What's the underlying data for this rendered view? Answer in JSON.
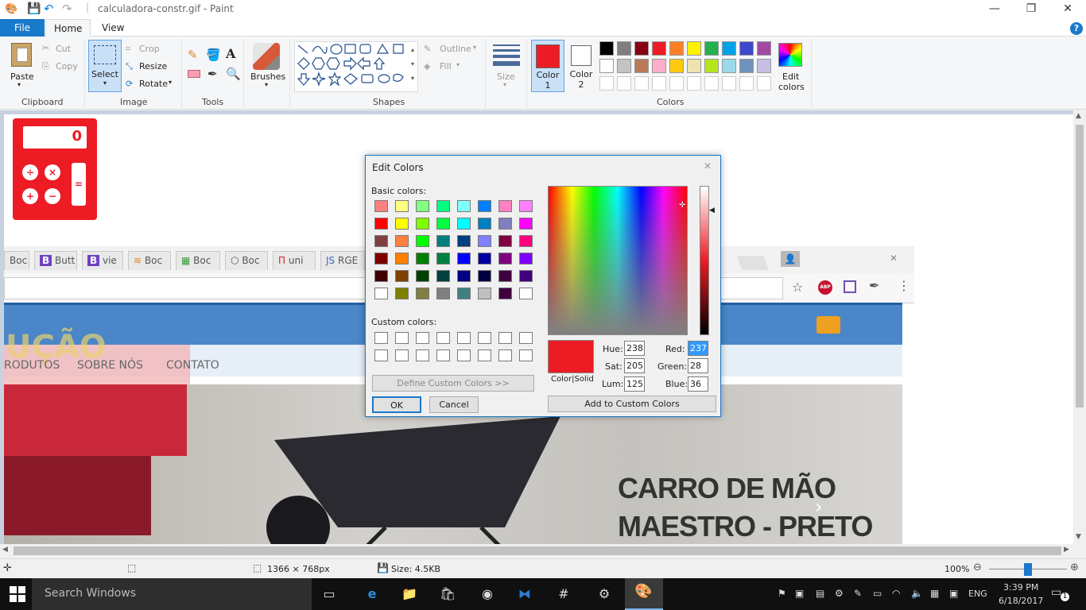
{
  "window": {
    "title": "calculadora-constr.gif - Paint"
  },
  "menu": {
    "file": "File",
    "home": "Home",
    "view": "View",
    "help": "?"
  },
  "clipboard": {
    "paste": "Paste",
    "cut": "Cut",
    "copy": "Copy",
    "label": "Clipboard"
  },
  "image": {
    "select": "Select",
    "crop": "Crop",
    "resize": "Resize",
    "rotate": "Rotate",
    "label": "Image"
  },
  "tools": {
    "label": "Tools",
    "text_tool": "A"
  },
  "brushes": {
    "label": "Brushes"
  },
  "shapes": {
    "label": "Shapes",
    "outline": "Outline",
    "fill": "Fill"
  },
  "size": {
    "label": "Size"
  },
  "colors": {
    "color1_label": "Color",
    "color1_num": "1",
    "color2_label": "Color",
    "color2_num": "2",
    "color1": "#ed1c24",
    "color2": "#ffffff",
    "edit_label": "Edit",
    "edit_label2": "colors",
    "label": "Colors",
    "row1": [
      "#000000",
      "#7f7f7f",
      "#880015",
      "#ed1c24",
      "#ff7f27",
      "#fff200",
      "#22b14c",
      "#00a2e8",
      "#3f48cc",
      "#a349a4"
    ],
    "row2": [
      "#ffffff",
      "#c3c3c3",
      "#b97a57",
      "#ffaec9",
      "#ffc90e",
      "#efe4b0",
      "#b5e61d",
      "#99d9ea",
      "#7092be",
      "#c8bfe7"
    ]
  },
  "dialog": {
    "title": "Edit Colors",
    "basic_label": "Basic colors:",
    "custom_label": "Custom colors:",
    "define_btn": "Define Custom Colors >>",
    "ok": "OK",
    "cancel": "Cancel",
    "add_btn": "Add to Custom Colors",
    "color_solid": "Color|Solid",
    "hue_label": "Hue:",
    "hue": "238",
    "sat_label": "Sat:",
    "sat": "205",
    "lum_label": "Lum:",
    "lum": "125",
    "red_label": "Red:",
    "red": "237",
    "green_label": "Green:",
    "green": "28",
    "blue_label": "Blue:",
    "blue": "36",
    "preview_color": "#ed1c24",
    "basic_colors": [
      [
        "#ff8080",
        "#ffff80",
        "#80ff80",
        "#00ff80",
        "#80ffff",
        "#0080ff",
        "#ff80c0",
        "#ff80ff"
      ],
      [
        "#ff0000",
        "#ffff00",
        "#80ff00",
        "#00ff40",
        "#00ffff",
        "#0080c0",
        "#8080c0",
        "#ff00ff"
      ],
      [
        "#804040",
        "#ff8040",
        "#00ff00",
        "#008080",
        "#004080",
        "#8080ff",
        "#800040",
        "#ff0080"
      ],
      [
        "#800000",
        "#ff8000",
        "#008000",
        "#008040",
        "#0000ff",
        "#0000a0",
        "#800080",
        "#8000ff"
      ],
      [
        "#400000",
        "#804000",
        "#004000",
        "#004040",
        "#000080",
        "#000040",
        "#400040",
        "#400080"
      ],
      [
        "#ffffff",
        "#808000",
        "#808040",
        "#808080",
        "#408080",
        "#c0c0c0",
        "#400040",
        "#ffffff"
      ]
    ]
  },
  "canvas_content": {
    "browser_tabs": [
      "Boc",
      "Butt",
      "vie",
      "Boc",
      "Boc",
      "Boc",
      "uni",
      "RGE"
    ],
    "nav": [
      "RODUTOS",
      "SOBRE NÓS",
      "CONTATO"
    ],
    "hero_title_1": "CARRO DE MÃO",
    "hero_title_2": "MAESTRO - PRETO",
    "hero_logo_text": "UÇÃO",
    "calc_display": "0",
    "abp": "ABP"
  },
  "status": {
    "dimensions": "1366 × 768px",
    "size": "Size: 4.5KB",
    "zoom": "100%"
  },
  "taskbar": {
    "search": "Search Windows",
    "lang": "ENG",
    "time": "3:39 PM",
    "date": "6/18/2017",
    "notif": "1"
  }
}
